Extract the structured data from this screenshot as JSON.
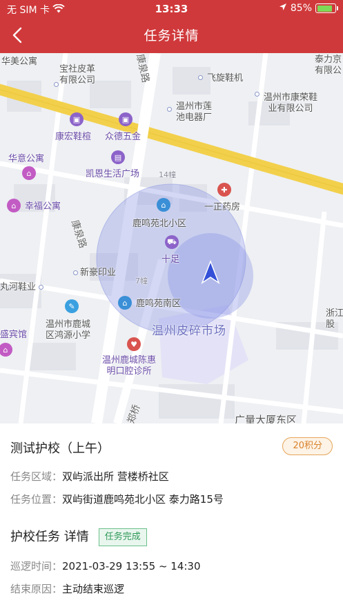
{
  "status_bar": {
    "carrier": "无 SIM 卡",
    "time": "13:33",
    "battery": "85%",
    "battery_level": 0.85
  },
  "nav": {
    "title": "任务详情"
  },
  "map": {
    "labels": {
      "huamei": "华美公寓",
      "baoshe": "宝社皮革\n有限公司",
      "kangquan_road_top": "康泉路",
      "feixuan": "飞旋鞋机",
      "taili": "泰力京\n有限公",
      "kangrong": "温州市康荣鞋\n业有限公司",
      "lianchi": "温州市莲\n池电器厂",
      "kanghong": "康宏鞋楦",
      "zhongde": "众德五金",
      "huayi": "华意公寓",
      "kaien": "凯恩生活广场",
      "bld14": "14幢",
      "yizheng": "一正药房",
      "xingfu": "幸福公寓",
      "luming_north": "鹿鸣苑北小区",
      "kangquan_road": "康泉路",
      "shizu": "十足",
      "xinhao": "新豪印业",
      "bld7": "7幢",
      "river_shoe": "丸河鞋业",
      "luming_south": "鹿鸣苑南区",
      "zhejiang": "浙江\n股",
      "school": "温州市鹿城\n区鸿源小学",
      "pisui": "温州皮碎市场",
      "hotel": "盛宾馆",
      "dental": "温州鹿城陈惠\n明口腔诊所",
      "zhengqiao": "郑桥",
      "guangsha": "广量大厦东区"
    }
  },
  "task": {
    "name": "测试护校（上午）",
    "points": "20积分",
    "area_label": "任务区域：",
    "area_value": "双屿派出所 营楼桥社区",
    "location_label": "任务位置：",
    "location_value": "双屿街道鹿鸣苑北小区 泰力路15号"
  },
  "detail": {
    "heading": "护校任务 详情",
    "status_tag": "任务完成",
    "patrol_label": "巡逻时间：",
    "patrol_value": "2021-03-29 13:55 ~ 14:30",
    "end_label": "结束原因：",
    "end_value": "主动结束巡逻"
  },
  "colors": {
    "brand_red": "#d0393b",
    "points_orange": "#d9822b",
    "done_green": "#2f9a58"
  },
  "icons": [
    "back-chevron-icon",
    "wifi-icon",
    "location-arrow-icon",
    "battery-icon",
    "navigation-arrow-icon"
  ]
}
